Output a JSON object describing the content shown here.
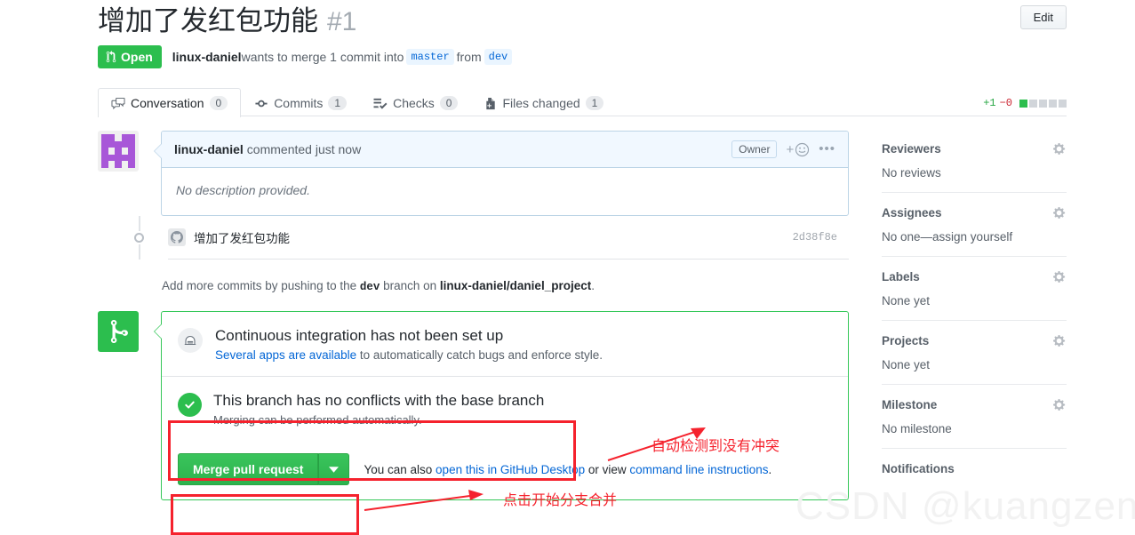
{
  "header": {
    "title": "增加了发红包功能",
    "number": "#1",
    "edit_label": "Edit",
    "state": "Open",
    "author": "linux-daniel",
    "meta_text_1": " wants to merge 1 commit into ",
    "base_branch": "master",
    "meta_text_2": " from ",
    "head_branch": "dev"
  },
  "tabs": [
    {
      "label": "Conversation",
      "count": "0",
      "icon": "comment-discussion-icon",
      "active": true
    },
    {
      "label": "Commits",
      "count": "1",
      "icon": "git-commit-icon",
      "active": false
    },
    {
      "label": "Checks",
      "count": "0",
      "icon": "checklist-icon",
      "active": false
    },
    {
      "label": "Files changed",
      "count": "1",
      "icon": "file-diff-icon",
      "active": false
    }
  ],
  "diffstat": {
    "additions": "+1",
    "deletions": "−0",
    "blocks_on": 1,
    "blocks_total": 5
  },
  "comment": {
    "author": "linux-daniel",
    "action": "commented just now",
    "badge": "Owner",
    "reaction_icon": "smiley-plus-icon",
    "menu_icon": "kebab-horizontal-icon",
    "body": "No description provided."
  },
  "commit": {
    "message": "增加了发红包功能",
    "sha": "2d38f8e",
    "avatar_icon": "octocat-icon"
  },
  "push_hint": {
    "prefix": "Add more commits by pushing to the ",
    "branch": "dev",
    "middle": " branch on ",
    "repo": "linux-daniel/daniel_project",
    "suffix": "."
  },
  "merge": {
    "badge_icon": "git-merge-icon",
    "ci": {
      "icon": "robot-icon",
      "title": "Continuous integration has not been set up",
      "link": "Several apps are available",
      "rest": " to automatically catch bugs and enforce style."
    },
    "conflict": {
      "icon": "check-circle-icon",
      "title": "This branch has no conflicts with the base branch",
      "subtitle": "Merging can be performed automatically."
    },
    "button_label": "Merge pull request",
    "caret_icon": "chevron-down-icon",
    "note_prefix": "You can also ",
    "note_link_1": "open this in GitHub Desktop",
    "note_middle": " or view ",
    "note_link_2": "command line instructions",
    "note_suffix": "."
  },
  "annotations": [
    {
      "text": "自动检测到没有冲突",
      "color": "#f5222d"
    },
    {
      "text": "点击开始分支合并",
      "color": "#f5222d"
    }
  ],
  "sidebar": [
    {
      "title": "Reviewers",
      "value": "No reviews",
      "gear": "gear-icon"
    },
    {
      "title": "Assignees",
      "value": "No one—assign yourself",
      "gear": "gear-icon"
    },
    {
      "title": "Labels",
      "value": "None yet",
      "gear": "gear-icon"
    },
    {
      "title": "Projects",
      "value": "None yet",
      "gear": "gear-icon"
    },
    {
      "title": "Milestone",
      "value": "No milestone",
      "gear": "gear-icon"
    },
    {
      "title": "Notifications",
      "value": "",
      "gear": ""
    }
  ],
  "watermark": "CSDN @kuangzeng"
}
